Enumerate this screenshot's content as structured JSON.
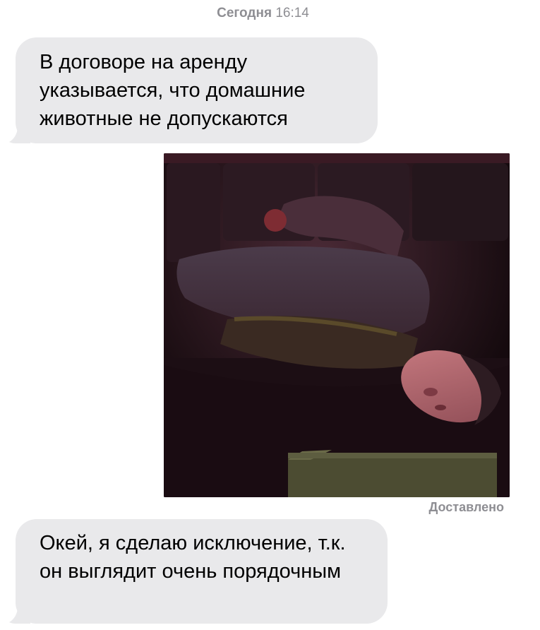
{
  "timestamp": {
    "day": "Сегодня",
    "time": "16:14"
  },
  "messages": [
    {
      "direction": "incoming",
      "text": "В договоре на аренду указывается, что домашние животные не допускаются"
    },
    {
      "direction": "outgoing",
      "type": "photo",
      "icon": "photo-man-lying-on-couch",
      "status": "Доставлено"
    },
    {
      "direction": "incoming",
      "text": "Окей, я сделаю исключение, т.к. он выглядит очень порядочным"
    }
  ],
  "colors": {
    "incoming_bubble": "#e9e9eb",
    "meta_text": "#8e8e93"
  }
}
